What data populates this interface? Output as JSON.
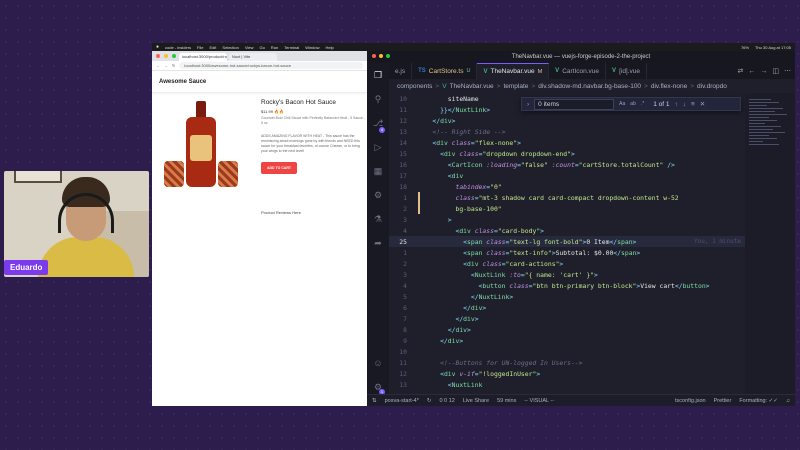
{
  "webcam": {
    "name": "Eduardo"
  },
  "menubar": {
    "apple": "",
    "items": [
      "code - insiders",
      "File",
      "Edit",
      "Selection",
      "View",
      "Go",
      "Run",
      "Terminal",
      "Window",
      "Help"
    ],
    "right": [
      "76%",
      "Thu 30 Aug at 17:05"
    ]
  },
  "browser": {
    "tabs": [
      "localhost:3000/product/rocky...",
      "Nuxt | Vite"
    ],
    "url": "localhost:3000/awesome-hot-sauce/rockys-bacon-hot-sauce",
    "site_title": "Awesome Sauce",
    "product": {
      "title": "Rocky's Bacon Hot Sauce",
      "price": "$11.99 🔥🔥",
      "subtitle": "Gourmet Bold Chili Sauce with Perfectly Balanced Heat - 5 Sauce - 5 oz",
      "description": "ADDS AMAZING FLAVOR WITH HEAT - This sauce has the reminiscing about mornings gone by with friends and NEED this sauce for your breakfast favorites, of course Cheese, or to bring your wings to the next level!",
      "add_to_cart": "ADD TO CART",
      "reviews": "Product Reviews Here"
    }
  },
  "vscode": {
    "title": "TheNavbar.vue — vuejs-forge-episode-2-the-project",
    "tabs": [
      {
        "icon": "JS",
        "label": "e.js",
        "marker": ""
      },
      {
        "icon": "TS",
        "label": "CartStore.ts",
        "marker": "U"
      },
      {
        "icon": "V",
        "label": "TheNavbar.vue",
        "marker": "M"
      },
      {
        "icon": "V",
        "label": "CartIcon.vue",
        "marker": ""
      },
      {
        "icon": "V",
        "label": "[id].vue",
        "marker": ""
      }
    ],
    "breadcrumb": [
      "components",
      ">",
      "TheNavbar.vue",
      ">",
      "template",
      ">",
      "div.shadow-md.navbar.bg-base-100",
      ">",
      "div.flex-none",
      ">",
      "div.dropdo"
    ],
    "find": {
      "query": "0 items",
      "count": "1 of 1"
    },
    "line_numbers": [
      "10",
      "11",
      "12",
      "13",
      "14",
      "15",
      "16",
      "17",
      "18",
      "1",
      "2",
      "3",
      "4",
      "5",
      "6",
      "25",
      "1",
      "2",
      "3",
      "4",
      "5",
      "6",
      "7",
      "8",
      "9",
      "10",
      "11",
      "12",
      "13"
    ],
    "blame": "You, 1 minute",
    "status": {
      "branch": "posva-start-4*",
      "problems": "0  0  12",
      "live_share": "Live Share",
      "time": "59 mins",
      "mode": "-- VISUAL --",
      "file": "tsconfig.json",
      "prettier": "Prettier",
      "formatting": "Formatting: ✓✓"
    }
  }
}
